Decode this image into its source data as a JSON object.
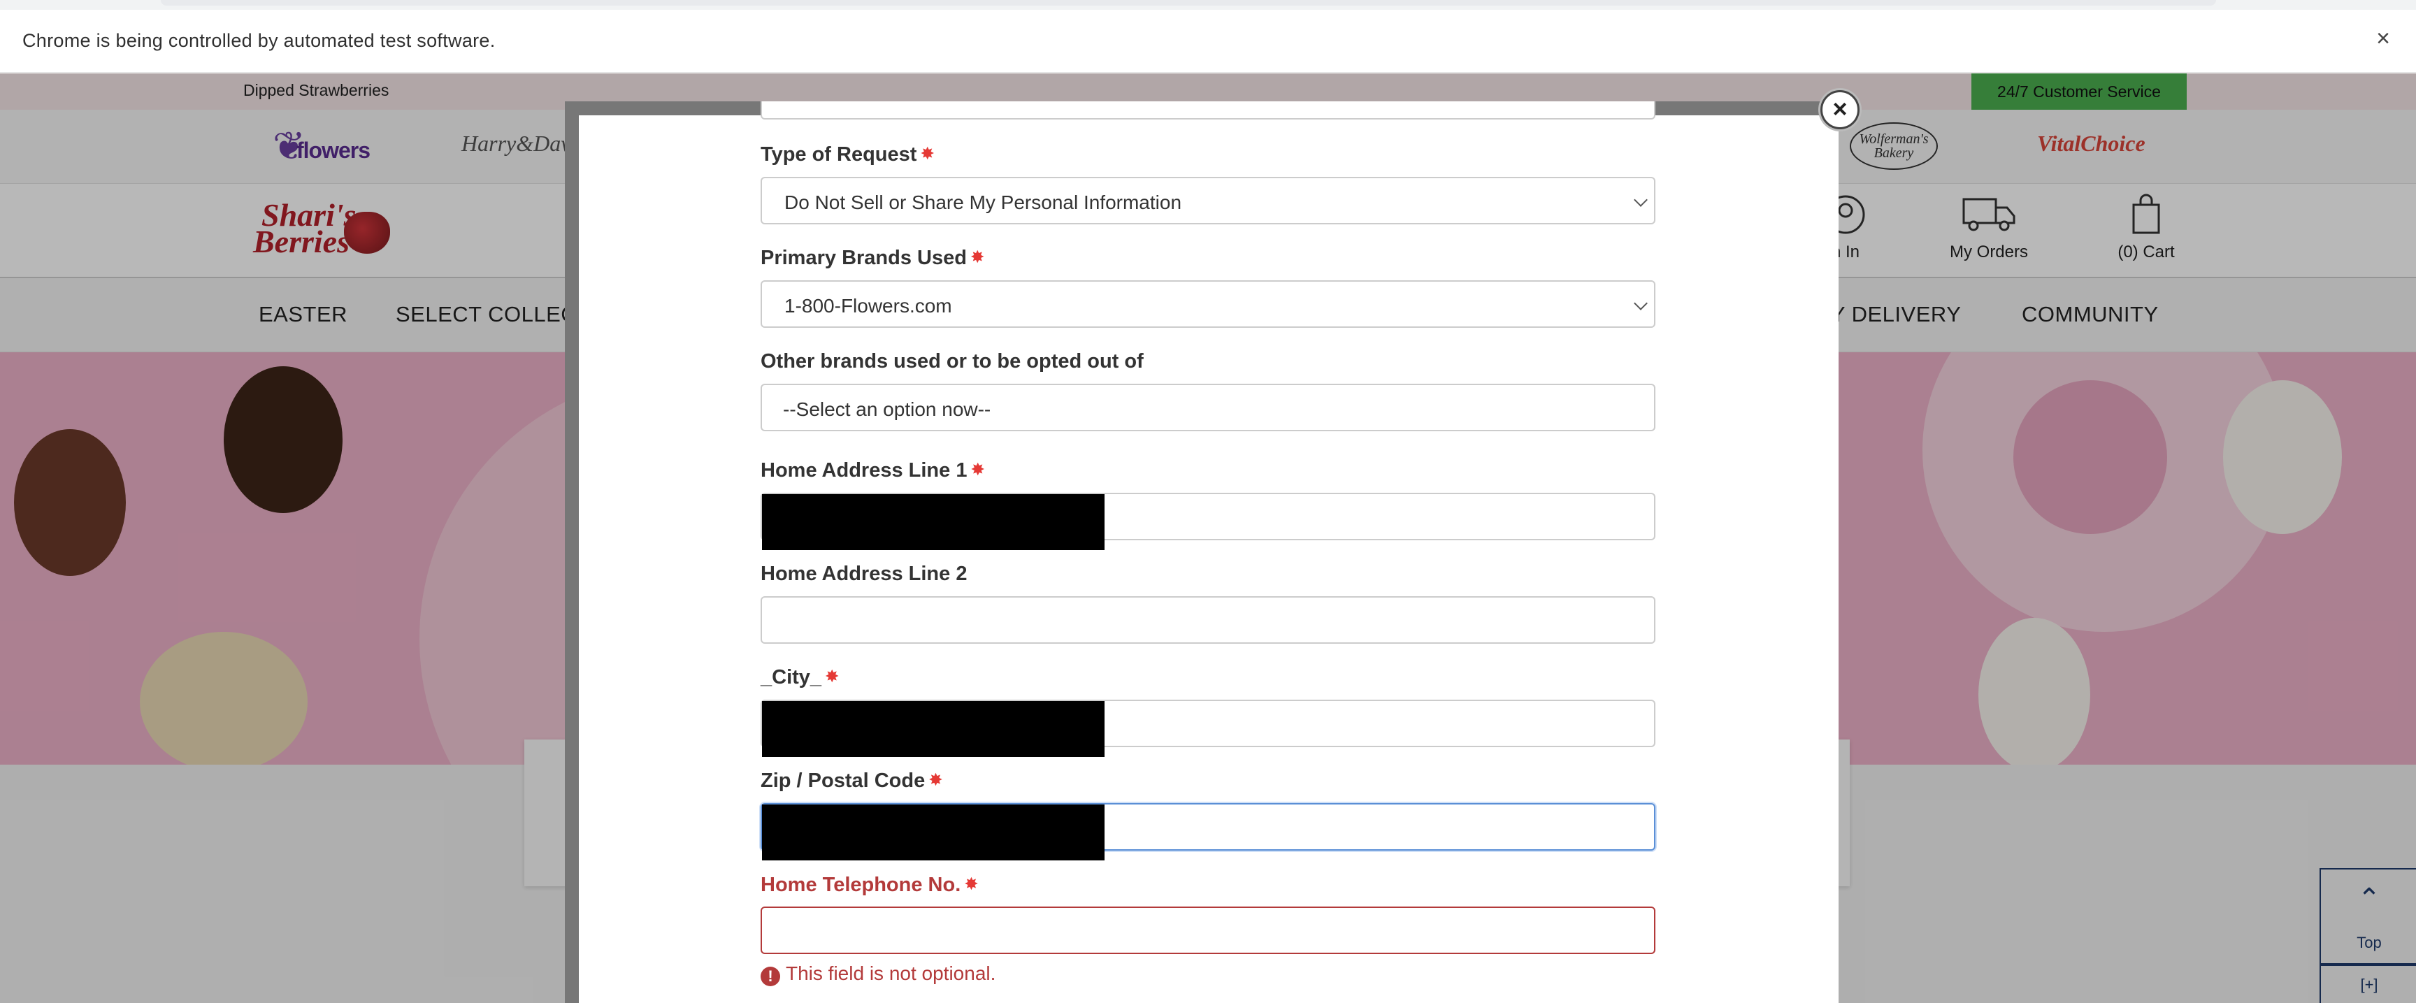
{
  "browser": {
    "infobar_message": "Chrome is being controlled by automated test software.",
    "close_glyph": "×"
  },
  "site": {
    "top_strip": {
      "left_link": "Dipped Strawberries",
      "customer_service": "24/7 Customer Service"
    },
    "brands": {
      "flowers_logo": "flowers",
      "flowers_logo_prefix": "1800",
      "harry_logo": "Harry&David",
      "wolfermans_logo": "Wolferman's Bakery",
      "vital_logo": "VitalChoice"
    },
    "shari_logo_line1": "Shari's",
    "shari_logo_line2": "Berries",
    "header_actions": {
      "sign_in": "n In",
      "my_orders": "My Orders",
      "cart": "(0) Cart"
    },
    "nav": {
      "easter": "EASTER",
      "select_collection": "SELECT COLLECTIO",
      "day_delivery": "AY DELIVERY",
      "community": "COMMUNITY"
    },
    "side_buttons": {
      "top_label": "Top",
      "top_glyph": "⌃",
      "plus_label": "[+]"
    }
  },
  "modal": {
    "close_glyph": "×",
    "required_marker": "✸",
    "fields": {
      "type_of_request": {
        "label": "Type of Request",
        "value": "Do Not Sell or Share My Personal Information"
      },
      "primary_brands": {
        "label": "Primary Brands Used",
        "value": "1-800-Flowers.com"
      },
      "other_brands": {
        "label": "Other brands used or to be opted out of",
        "value": "--Select an option now--"
      },
      "address_1": {
        "label": "Home Address Line 1",
        "value": ""
      },
      "address_2": {
        "label": "Home Address Line 2",
        "value": ""
      },
      "city": {
        "label": "_City_",
        "value": ""
      },
      "zip": {
        "label": "Zip / Postal Code",
        "value": ""
      },
      "telephone": {
        "label": "Home Telephone No.",
        "value": "",
        "error": "This field is not optional."
      }
    },
    "error_icon_glyph": "!"
  },
  "colors": {
    "required_star": "#e53935",
    "error": "#b33a3a",
    "focus_border": "#5b8fd6",
    "customer_service_bg": "#4caf50",
    "hero_bg": "#eeb2c9"
  }
}
